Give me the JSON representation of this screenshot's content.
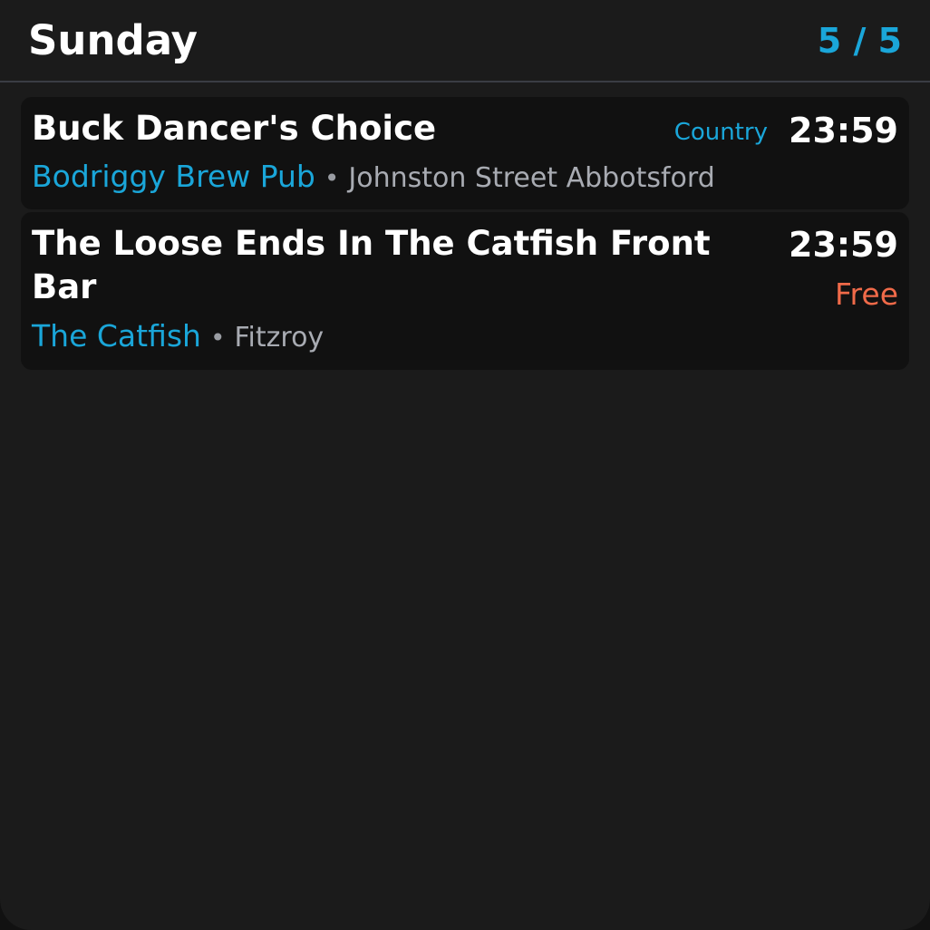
{
  "header": {
    "day": "Sunday",
    "pager": "5 / 5"
  },
  "events": [
    {
      "title": "Buck Dancer's Choice",
      "genre": "Country",
      "time": "23:59",
      "venue": "Bodriggy Brew Pub",
      "separator": "•",
      "suburb": "Johnston Street Abbotsford"
    },
    {
      "title": "The Loose Ends In The Catfish Front Bar",
      "time": "23:59",
      "price": "Free",
      "venue": "The Catfish",
      "separator": "•",
      "suburb": "Fitzroy"
    }
  ],
  "colors": {
    "background": "#1b1b1b",
    "card": "#111111",
    "accent": "#1aa6d9",
    "price": "#f06a49",
    "muted": "#a8abb2"
  }
}
